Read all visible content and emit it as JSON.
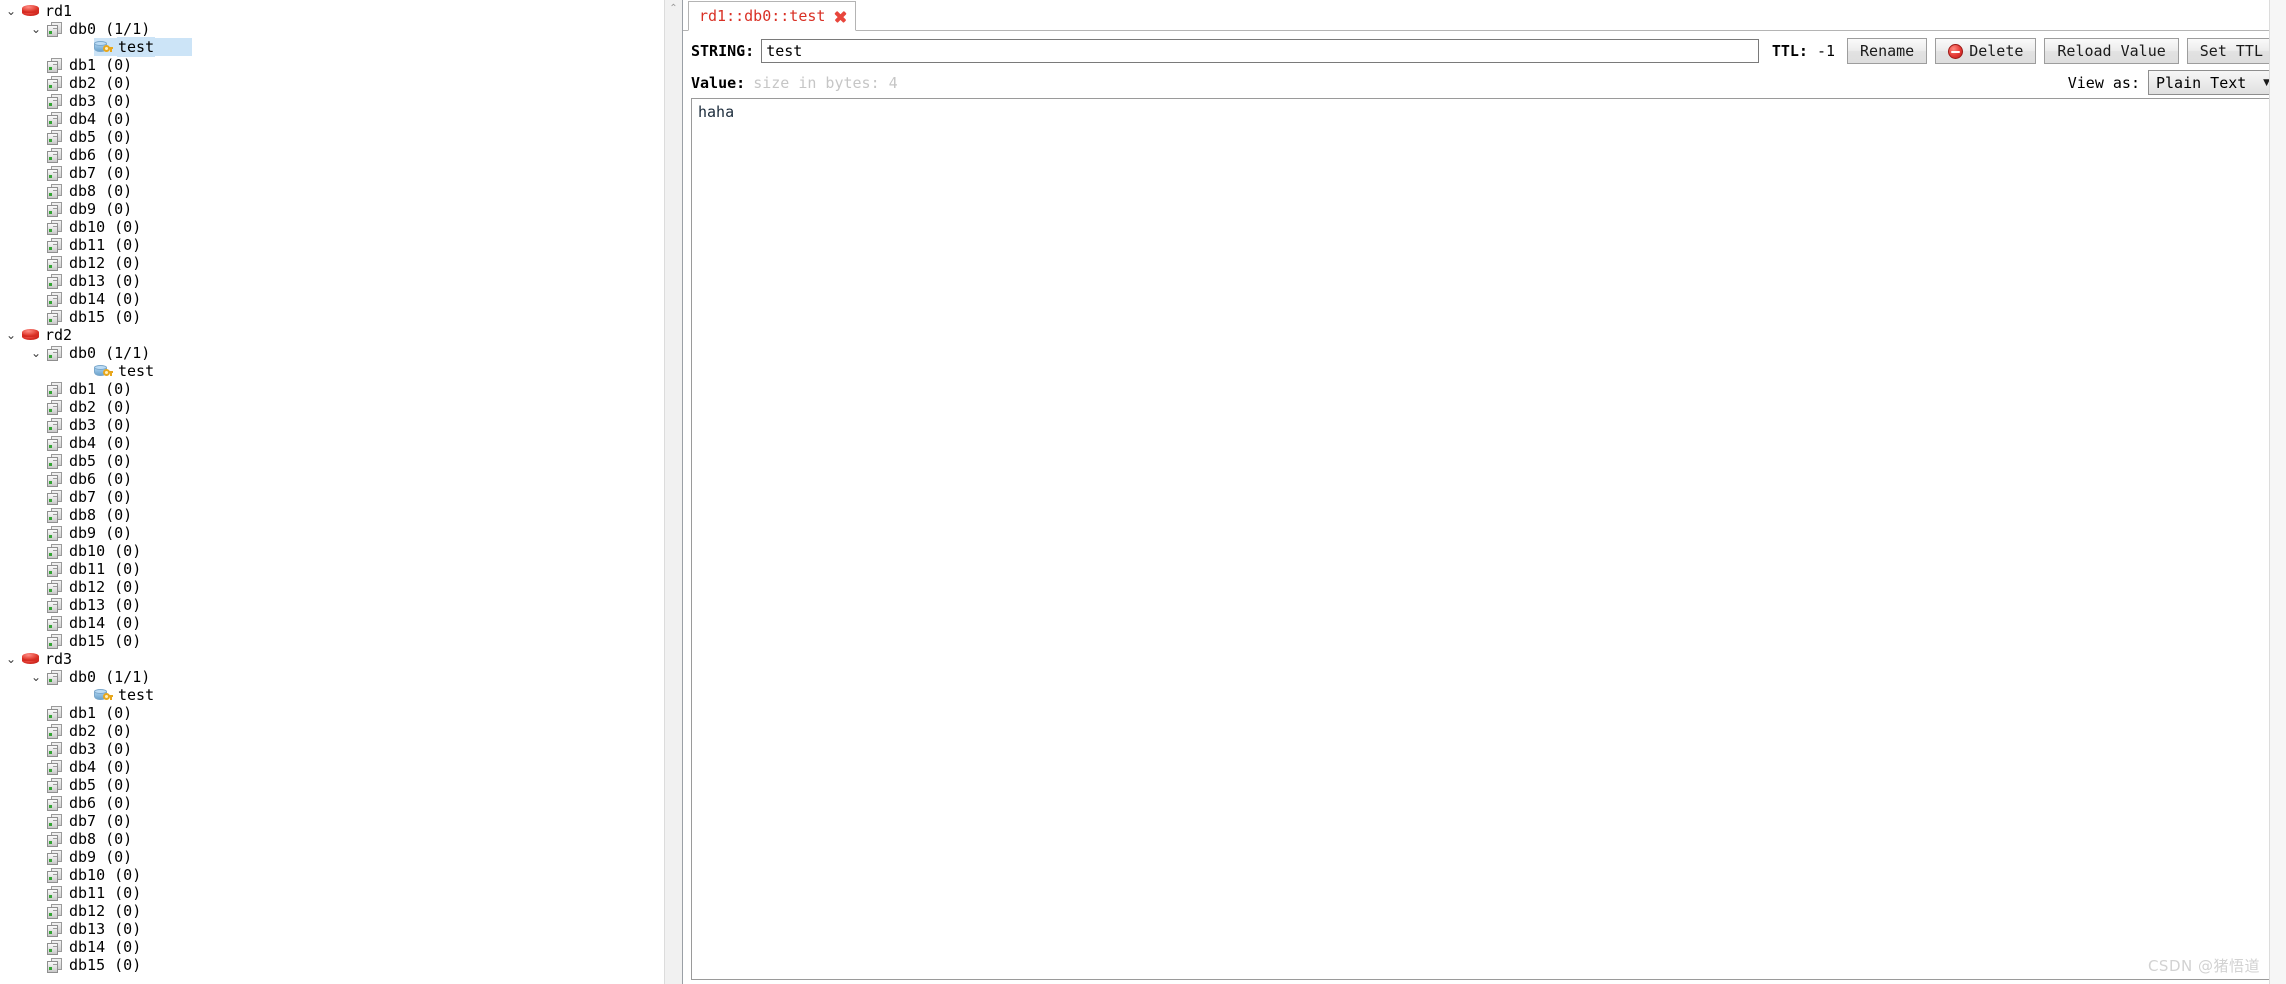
{
  "tree": {
    "scrollbar": {
      "up_arrow": "⌃"
    },
    "servers": [
      {
        "name": "rd1",
        "expanded": true,
        "databases": [
          {
            "label": "db0  (1/1)",
            "expanded": true,
            "keys": [
              {
                "label": "test",
                "selected": true
              }
            ]
          },
          {
            "label": "db1 (0)",
            "expanded": false,
            "keys": []
          },
          {
            "label": "db2 (0)",
            "expanded": false,
            "keys": []
          },
          {
            "label": "db3 (0)",
            "expanded": false,
            "keys": []
          },
          {
            "label": "db4 (0)",
            "expanded": false,
            "keys": []
          },
          {
            "label": "db5 (0)",
            "expanded": false,
            "keys": []
          },
          {
            "label": "db6 (0)",
            "expanded": false,
            "keys": []
          },
          {
            "label": "db7 (0)",
            "expanded": false,
            "keys": []
          },
          {
            "label": "db8 (0)",
            "expanded": false,
            "keys": []
          },
          {
            "label": "db9 (0)",
            "expanded": false,
            "keys": []
          },
          {
            "label": "db10 (0)",
            "expanded": false,
            "keys": []
          },
          {
            "label": "db11 (0)",
            "expanded": false,
            "keys": []
          },
          {
            "label": "db12 (0)",
            "expanded": false,
            "keys": []
          },
          {
            "label": "db13 (0)",
            "expanded": false,
            "keys": []
          },
          {
            "label": "db14 (0)",
            "expanded": false,
            "keys": []
          },
          {
            "label": "db15 (0)",
            "expanded": false,
            "keys": []
          }
        ]
      },
      {
        "name": "rd2",
        "expanded": true,
        "databases": [
          {
            "label": "db0  (1/1)",
            "expanded": true,
            "keys": [
              {
                "label": "test",
                "selected": false
              }
            ]
          },
          {
            "label": "db1 (0)",
            "expanded": false,
            "keys": []
          },
          {
            "label": "db2 (0)",
            "expanded": false,
            "keys": []
          },
          {
            "label": "db3 (0)",
            "expanded": false,
            "keys": []
          },
          {
            "label": "db4 (0)",
            "expanded": false,
            "keys": []
          },
          {
            "label": "db5 (0)",
            "expanded": false,
            "keys": []
          },
          {
            "label": "db6 (0)",
            "expanded": false,
            "keys": []
          },
          {
            "label": "db7 (0)",
            "expanded": false,
            "keys": []
          },
          {
            "label": "db8 (0)",
            "expanded": false,
            "keys": []
          },
          {
            "label": "db9 (0)",
            "expanded": false,
            "keys": []
          },
          {
            "label": "db10 (0)",
            "expanded": false,
            "keys": []
          },
          {
            "label": "db11 (0)",
            "expanded": false,
            "keys": []
          },
          {
            "label": "db12 (0)",
            "expanded": false,
            "keys": []
          },
          {
            "label": "db13 (0)",
            "expanded": false,
            "keys": []
          },
          {
            "label": "db14 (0)",
            "expanded": false,
            "keys": []
          },
          {
            "label": "db15 (0)",
            "expanded": false,
            "keys": []
          }
        ]
      },
      {
        "name": "rd3",
        "expanded": true,
        "databases": [
          {
            "label": "db0  (1/1)",
            "expanded": true,
            "keys": [
              {
                "label": "test",
                "selected": false
              }
            ]
          },
          {
            "label": "db1 (0)",
            "expanded": false,
            "keys": []
          },
          {
            "label": "db2 (0)",
            "expanded": false,
            "keys": []
          },
          {
            "label": "db3 (0)",
            "expanded": false,
            "keys": []
          },
          {
            "label": "db4 (0)",
            "expanded": false,
            "keys": []
          },
          {
            "label": "db5 (0)",
            "expanded": false,
            "keys": []
          },
          {
            "label": "db6 (0)",
            "expanded": false,
            "keys": []
          },
          {
            "label": "db7 (0)",
            "expanded": false,
            "keys": []
          },
          {
            "label": "db8 (0)",
            "expanded": false,
            "keys": []
          },
          {
            "label": "db9 (0)",
            "expanded": false,
            "keys": []
          },
          {
            "label": "db10 (0)",
            "expanded": false,
            "keys": []
          },
          {
            "label": "db11 (0)",
            "expanded": false,
            "keys": []
          },
          {
            "label": "db12 (0)",
            "expanded": false,
            "keys": []
          },
          {
            "label": "db13 (0)",
            "expanded": false,
            "keys": []
          },
          {
            "label": "db14 (0)",
            "expanded": false,
            "keys": []
          },
          {
            "label": "db15 (0)",
            "expanded": false,
            "keys": []
          }
        ]
      }
    ],
    "chevron_expanded": "⌄",
    "icons": {
      "server": "redis-server-icon",
      "database": "database-icon",
      "key": "key-icon"
    }
  },
  "tabs": [
    {
      "label": "rd1::db0::test",
      "active": true,
      "close_icon": "close-icon"
    }
  ],
  "key_editor": {
    "type_label": "STRING:",
    "key_name": "test",
    "key_placeholder": "",
    "ttl_label": "TTL:",
    "ttl_value": "-1",
    "buttons": {
      "rename": "Rename",
      "delete": "Delete",
      "reload": "Reload Value",
      "set_ttl": "Set TTL"
    }
  },
  "value_section": {
    "value_label": "Value:",
    "size_text": "size in bytes: 4",
    "view_as_label": "View as:",
    "view_as_value": "Plain Text",
    "view_as_caret": "▼",
    "value_content": "haha"
  },
  "watermark": "CSDN @猪悟道",
  "colors": {
    "tab_text": "#d93025",
    "selection": "#cce4f7",
    "redis_icon": "#d62b22",
    "delete_icon": "#e53935",
    "placeholder_gray": "#c6c6c6"
  }
}
